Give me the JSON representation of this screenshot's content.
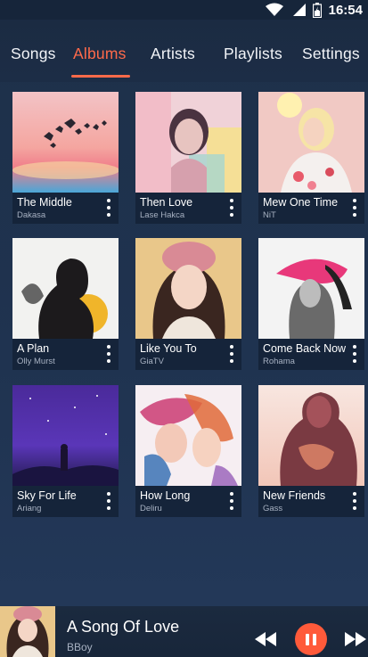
{
  "status": {
    "time": "16:54",
    "icons": [
      "wifi-icon",
      "signal-icon",
      "battery-icon"
    ]
  },
  "tabs": [
    {
      "label": "Songs",
      "active": false
    },
    {
      "label": "Albums",
      "active": true
    },
    {
      "label": "Artists",
      "active": false
    },
    {
      "label": "Playlists",
      "active": false
    },
    {
      "label": "Settings",
      "active": false
    }
  ],
  "accent": "#ff6a4a",
  "albums": [
    {
      "title": "The Middle",
      "artist": "Dakasa"
    },
    {
      "title": "Then Love",
      "artist": "Lase Hakca"
    },
    {
      "title": "Mew One Time",
      "artist": "NiT"
    },
    {
      "title": "A Plan",
      "artist": "Olly Murst"
    },
    {
      "title": "Like You To",
      "artist": "GiaTV"
    },
    {
      "title": "Come Back Now",
      "artist": "Rohama"
    },
    {
      "title": "Sky For Life",
      "artist": "Ariang"
    },
    {
      "title": "How Long",
      "artist": "Deliru"
    },
    {
      "title": "New Friends",
      "artist": "Gass"
    }
  ],
  "now_playing": {
    "title": "A Song Of Love",
    "artist": "BBoy"
  }
}
